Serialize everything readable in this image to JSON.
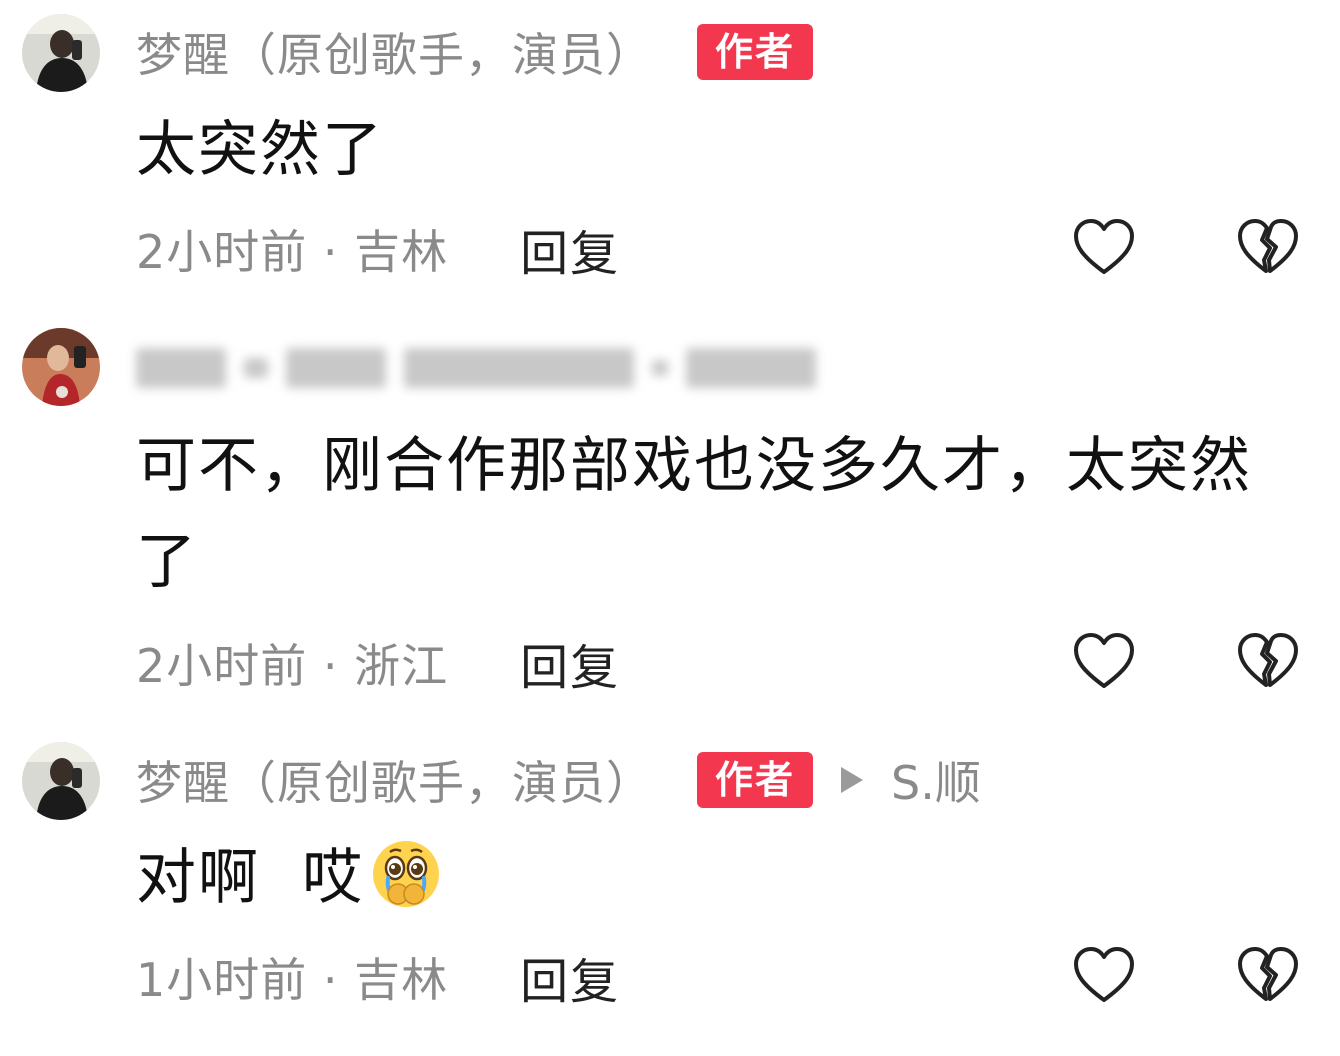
{
  "comments": [
    {
      "username": "梦醒（原创歌手，演员）",
      "badge": "作者",
      "text": "太突然了",
      "time_location": "2小时前 · 吉林",
      "reply_label": "回复"
    },
    {
      "username": "",
      "text": "可不，刚合作那部戏也没多久才，太突然了",
      "time_location": "2小时前 · 浙江",
      "reply_label": "回复"
    },
    {
      "username": "梦醒（原创歌手，演员）",
      "badge": "作者",
      "reply_to": "S.顺",
      "text": "对啊  哎",
      "emoji": "crying-face-emoji",
      "time_location": "1小时前 · 吉林",
      "reply_label": "回复"
    }
  ],
  "colors": {
    "badge_bg": "#f2374f",
    "secondary_text": "#8a8a8a",
    "primary_text": "#111111"
  },
  "icons": [
    "heart-outline-icon",
    "broken-heart-icon",
    "play-triangle-icon"
  ]
}
